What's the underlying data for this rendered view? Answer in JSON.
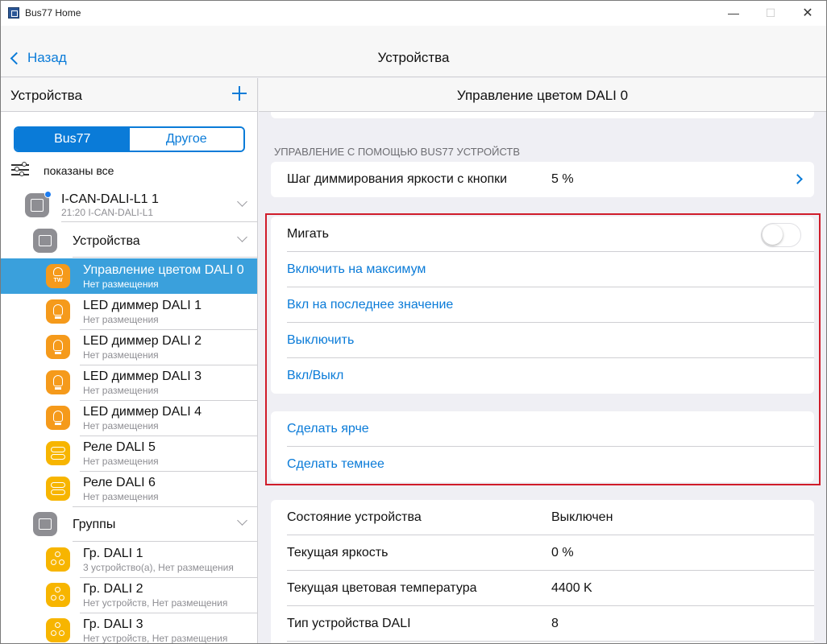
{
  "window": {
    "title": "Bus77 Home",
    "minimize": "—",
    "maximize": "☐",
    "close": "✕"
  },
  "nav": {
    "back_label": "Назад",
    "title": "Устройства"
  },
  "left": {
    "header_title": "Устройства",
    "segments": {
      "active": "Bus77",
      "inactive": "Другое"
    },
    "filter_text": "показаны все",
    "device": {
      "title": "I-CAN-DALI-L1 1",
      "subtitle": "21:20 I-CAN-DALI-L1"
    },
    "devices_group": {
      "title": "Устройства"
    },
    "items": [
      {
        "title": "Управление цветом DALI 0",
        "subtitle": "Нет размещения",
        "icon_badge": "TW"
      },
      {
        "title": "LED диммер DALI 1",
        "subtitle": "Нет размещения"
      },
      {
        "title": "LED диммер DALI 2",
        "subtitle": "Нет размещения"
      },
      {
        "title": "LED диммер DALI 3",
        "subtitle": "Нет размещения"
      },
      {
        "title": "LED диммер DALI 4",
        "subtitle": "Нет размещения"
      },
      {
        "title": "Реле DALI 5",
        "subtitle": "Нет размещения"
      },
      {
        "title": "Реле DALI 6",
        "subtitle": "Нет размещения"
      }
    ],
    "groups_group": {
      "title": "Группы"
    },
    "groups": [
      {
        "title": "Гр. DALI 1",
        "subtitle": "3 устройство(а), Нет размещения"
      },
      {
        "title": "Гр. DALI 2",
        "subtitle": "Нет устройств, Нет размещения"
      },
      {
        "title": "Гр. DALI 3",
        "subtitle": "Нет устройств, Нет размещения"
      }
    ]
  },
  "right": {
    "header_title": "Управление цветом DALI 0",
    "section_label": "УПРАВЛЕНИЕ С ПОМОЩЬЮ BUS77 УСТРОЙСТВ",
    "dimming": {
      "label": "Шаг диммирования яркости с кнопки",
      "value": "5 %"
    },
    "blink": {
      "label": "Мигать",
      "on": false
    },
    "actions": [
      "Включить на максимум",
      "Вкл на последнее значение",
      "Выключить",
      "Вкл/Выкл"
    ],
    "adjust": [
      "Сделать ярче",
      "Сделать темнее"
    ],
    "status": [
      {
        "label": "Состояние устройства",
        "value": "Выключен"
      },
      {
        "label": "Текущая яркость",
        "value": "0 %"
      },
      {
        "label": "Текущая цветовая температура",
        "value": "4400 K"
      },
      {
        "label": "Тип устройства DALI",
        "value": "8"
      }
    ]
  },
  "colors": {
    "accent": "#0a7bd8",
    "selected": "#3aa0dc",
    "orange": "#f59a1b",
    "yellow": "#f7b500",
    "highlight_border": "#d01c2a"
  }
}
